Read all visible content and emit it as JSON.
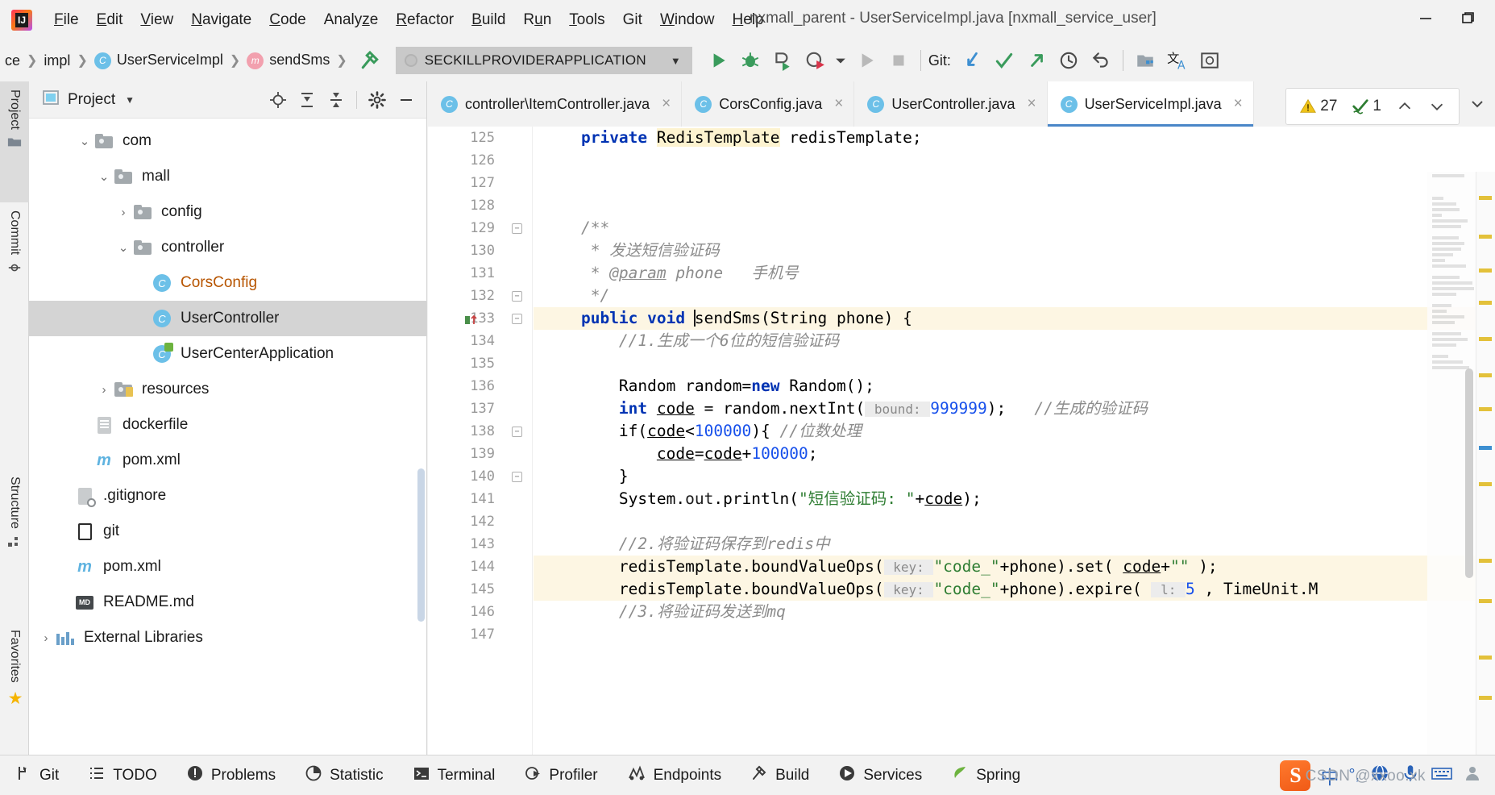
{
  "window": {
    "title": "nxmall_parent - UserServiceImpl.java [nxmall_service_user]",
    "minimize_icon": "minimize-icon",
    "restore_icon": "restore-icon"
  },
  "menubar": {
    "logo": "intellij-idea-logo",
    "items": [
      {
        "label": "File",
        "mnemonic": "F"
      },
      {
        "label": "Edit",
        "mnemonic": "E"
      },
      {
        "label": "View",
        "mnemonic": "V"
      },
      {
        "label": "Navigate",
        "mnemonic": "N"
      },
      {
        "label": "Code",
        "mnemonic": "C"
      },
      {
        "label": "Analyze",
        "mnemonic": "z"
      },
      {
        "label": "Refactor",
        "mnemonic": "R"
      },
      {
        "label": "Build",
        "mnemonic": "B"
      },
      {
        "label": "Run",
        "mnemonic": "u"
      },
      {
        "label": "Tools",
        "mnemonic": "T"
      },
      {
        "label": "Git",
        "mnemonic": ""
      },
      {
        "label": "Window",
        "mnemonic": "W"
      },
      {
        "label": "Help",
        "mnemonic": "H"
      }
    ]
  },
  "navbar": {
    "breadcrumbs": [
      {
        "label": "ce",
        "icon": "none"
      },
      {
        "label": "impl",
        "icon": "none"
      },
      {
        "label": "UserServiceImpl",
        "icon": "class-icon"
      },
      {
        "label": "sendSms",
        "icon": "method-icon"
      }
    ],
    "build_icon": "hammer-icon",
    "run_configuration": "SECKILLPROVIDERAPPLICATION",
    "run_config_arrow": "chevron-down-icon",
    "toolbar_icons": [
      "run-icon",
      "debug-icon",
      "run-with-coverage-icon",
      "profile-icon",
      "dropdown-icon",
      "rerun-icon",
      "stop-icon"
    ],
    "git_label": "Git:",
    "git_icons": [
      "update-project-icon",
      "commit-icon",
      "push-icon",
      "history-icon",
      "rollback-icon"
    ],
    "right_icons": [
      "project-structure-icon",
      "translate-icon",
      "search-everywhere-icon"
    ]
  },
  "left_stripe": {
    "items": [
      {
        "label": "Project",
        "icon": "project-folder-icon",
        "active": true
      },
      {
        "label": "Commit",
        "icon": "commit-diamond-icon",
        "active": false
      },
      {
        "label": "Structure",
        "icon": "structure-icon",
        "active": false
      },
      {
        "label": "Favorites",
        "icon": "star-icon",
        "active": false
      }
    ]
  },
  "project_panel": {
    "title": "Project",
    "title_caret": "chevron-down-icon",
    "actions": [
      "locate-icon",
      "expand-all-icon",
      "collapse-all-icon",
      "gear-icon",
      "hide-icon"
    ],
    "tree": [
      {
        "label": "com",
        "icon": "folder-icon",
        "arrow": "expanded",
        "indent": 3,
        "selected": false
      },
      {
        "label": "mall",
        "icon": "folder-icon",
        "arrow": "expanded",
        "indent": 4,
        "selected": false
      },
      {
        "label": "config",
        "icon": "folder-icon",
        "arrow": "collapsed",
        "indent": 5,
        "selected": false
      },
      {
        "label": "controller",
        "icon": "folder-icon",
        "arrow": "expanded",
        "indent": 5,
        "selected": false
      },
      {
        "label": "CorsConfig",
        "icon": "class-icon",
        "arrow": "none",
        "indent": 6,
        "selected": false,
        "color": "orange"
      },
      {
        "label": "UserController",
        "icon": "class-icon",
        "arrow": "none",
        "indent": 6,
        "selected": true
      },
      {
        "label": "UserCenterApplication",
        "icon": "spring-class-icon",
        "arrow": "none",
        "indent": 6,
        "selected": false
      },
      {
        "label": "resources",
        "icon": "resources-folder-icon",
        "arrow": "collapsed",
        "indent": 4,
        "selected": false
      },
      {
        "label": "dockerfile",
        "icon": "file-icon",
        "arrow": "none",
        "indent": 3,
        "selected": false
      },
      {
        "label": "pom.xml",
        "icon": "maven-icon",
        "arrow": "none",
        "indent": 3,
        "selected": false
      },
      {
        "label": ".gitignore",
        "icon": "gitignore-icon",
        "arrow": "none",
        "indent": 2,
        "selected": false
      },
      {
        "label": "git",
        "icon": "plain-file-icon",
        "arrow": "none",
        "indent": 2,
        "selected": false
      },
      {
        "label": "pom.xml",
        "icon": "maven-icon",
        "arrow": "none",
        "indent": 2,
        "selected": false
      },
      {
        "label": "README.md",
        "icon": "markdown-icon",
        "arrow": "none",
        "indent": 2,
        "selected": false
      },
      {
        "label": "External Libraries",
        "icon": "libraries-icon",
        "arrow": "collapsed",
        "indent": 1,
        "selected": false
      }
    ]
  },
  "editor": {
    "tabs": [
      {
        "label": "controller\\ItemController.java",
        "icon": "class-icon",
        "active": false,
        "close": "×"
      },
      {
        "label": "CorsConfig.java",
        "icon": "class-icon",
        "active": false,
        "close": "×"
      },
      {
        "label": "UserController.java",
        "icon": "class-icon",
        "active": false,
        "close": "×"
      },
      {
        "label": "UserServiceImpl.java",
        "icon": "class-icon",
        "active": true,
        "close": "×"
      }
    ],
    "tab_overflow_icon": "chevron-down-icon",
    "inspection": {
      "warning_icon": "warning-triangle-icon",
      "warning_count": "27",
      "ok_icon": "inspection-ok-icon",
      "ok_count": "1",
      "prev_icon": "chevron-up-icon",
      "next_icon": "chevron-down-icon"
    },
    "first_line_number": 125,
    "lines": [
      {
        "n": 125,
        "fold": false,
        "marker": "",
        "highlight": false,
        "partial": true,
        "tokens": [
          {
            "t": "    ",
            "c": "pl"
          },
          {
            "t": "private ",
            "c": "kw"
          },
          {
            "t": "RedisTemplate",
            "c": "ylwhl"
          },
          {
            "t": " redisTemplate;",
            "c": "pl"
          }
        ]
      },
      {
        "n": 126,
        "fold": false,
        "marker": "",
        "tokens": []
      },
      {
        "n": 127,
        "fold": false,
        "marker": "",
        "tokens": []
      },
      {
        "n": 128,
        "fold": false,
        "marker": "",
        "tokens": []
      },
      {
        "n": 129,
        "fold": true,
        "marker": "",
        "tokens": [
          {
            "t": "    /**",
            "c": "jd"
          }
        ]
      },
      {
        "n": 130,
        "fold": false,
        "marker": "",
        "tokens": [
          {
            "t": "     * 发送短信验证码",
            "c": "jd"
          }
        ]
      },
      {
        "n": 131,
        "fold": false,
        "marker": "",
        "tokens": [
          {
            "t": "     * ",
            "c": "jd"
          },
          {
            "t": "@param",
            "c": "jdtag"
          },
          {
            "t": " phone   手机号",
            "c": "jd"
          }
        ]
      },
      {
        "n": 132,
        "fold": true,
        "marker": "",
        "tokens": [
          {
            "t": "     */",
            "c": "jd"
          }
        ]
      },
      {
        "n": 133,
        "fold": true,
        "marker": "override-icon",
        "highlight": true,
        "tokens": [
          {
            "t": "    ",
            "c": "pl"
          },
          {
            "t": "public ",
            "c": "kw"
          },
          {
            "t": "void ",
            "c": "kw"
          },
          {
            "t": "|",
            "c": "caret"
          },
          {
            "t": "sendSms(String phone) {",
            "c": "pl"
          }
        ]
      },
      {
        "n": 134,
        "fold": false,
        "marker": "",
        "tokens": [
          {
            "t": "        //1.生成一个6位的短信验证码",
            "c": "cm"
          }
        ]
      },
      {
        "n": 135,
        "fold": false,
        "marker": "",
        "tokens": []
      },
      {
        "n": 136,
        "fold": false,
        "marker": "",
        "tokens": [
          {
            "t": "        Random random=",
            "c": "pl"
          },
          {
            "t": "new ",
            "c": "kw"
          },
          {
            "t": "Random();",
            "c": "pl"
          }
        ]
      },
      {
        "n": 137,
        "fold": false,
        "marker": "",
        "tokens": [
          {
            "t": "        ",
            "c": "pl"
          },
          {
            "t": "int ",
            "c": "kw"
          },
          {
            "t": "code",
            "c": "und"
          },
          {
            "t": " = random.nextInt(",
            "c": "pl"
          },
          {
            "t": " bound: ",
            "c": "hintbg"
          },
          {
            "t": "999999",
            "c": "num"
          },
          {
            "t": ");   ",
            "c": "pl"
          },
          {
            "t": "//生成的验证码",
            "c": "cm"
          }
        ]
      },
      {
        "n": 138,
        "fold": true,
        "marker": "",
        "tokens": [
          {
            "t": "        if(",
            "c": "pl"
          },
          {
            "t": "code",
            "c": "und"
          },
          {
            "t": "<",
            "c": "pl"
          },
          {
            "t": "100000",
            "c": "num"
          },
          {
            "t": "){ ",
            "c": "pl"
          },
          {
            "t": "//位数处理",
            "c": "cm"
          }
        ]
      },
      {
        "n": 139,
        "fold": false,
        "marker": "",
        "tokens": [
          {
            "t": "            ",
            "c": "pl"
          },
          {
            "t": "code",
            "c": "und"
          },
          {
            "t": "=",
            "c": "pl"
          },
          {
            "t": "code",
            "c": "und"
          },
          {
            "t": "+",
            "c": "pl"
          },
          {
            "t": "100000",
            "c": "num"
          },
          {
            "t": ";",
            "c": "pl"
          }
        ]
      },
      {
        "n": 140,
        "fold": true,
        "marker": "",
        "tokens": [
          {
            "t": "        }",
            "c": "pl"
          }
        ]
      },
      {
        "n": 141,
        "fold": false,
        "marker": "",
        "tokens": [
          {
            "t": "        System.",
            "c": "pl"
          },
          {
            "t": "out",
            "c": "fld2"
          },
          {
            "t": ".println(",
            "c": "pl"
          },
          {
            "t": "\"短信验证码: \"",
            "c": "str"
          },
          {
            "t": "+",
            "c": "pl"
          },
          {
            "t": "code",
            "c": "und"
          },
          {
            "t": ");",
            "c": "pl"
          }
        ]
      },
      {
        "n": 142,
        "fold": false,
        "marker": "",
        "tokens": []
      },
      {
        "n": 143,
        "fold": false,
        "marker": "",
        "tokens": [
          {
            "t": "        //2.将验证码保存到redis中",
            "c": "cm"
          }
        ]
      },
      {
        "n": 144,
        "fold": false,
        "marker": "",
        "highlight": true,
        "tokens": [
          {
            "t": "        redisTemplate.boundValueOps(",
            "c": "pl"
          },
          {
            "t": " key: ",
            "c": "hintbg"
          },
          {
            "t": "\"code_\"",
            "c": "str"
          },
          {
            "t": "+phone).set( ",
            "c": "pl"
          },
          {
            "t": "code",
            "c": "und"
          },
          {
            "t": "+",
            "c": "pl"
          },
          {
            "t": "\"\"",
            "c": "str"
          },
          {
            "t": " );",
            "c": "pl"
          }
        ]
      },
      {
        "n": 145,
        "fold": false,
        "marker": "",
        "highlight": true,
        "tokens": [
          {
            "t": "        redisTemplate.boundValueOps(",
            "c": "pl"
          },
          {
            "t": " key: ",
            "c": "hintbg"
          },
          {
            "t": "\"code_\"",
            "c": "str"
          },
          {
            "t": "+phone).expire( ",
            "c": "pl"
          },
          {
            "t": " l: ",
            "c": "hintbg"
          },
          {
            "t": "5",
            "c": "num"
          },
          {
            "t": " , TimeUnit.M",
            "c": "pl"
          }
        ]
      },
      {
        "n": 146,
        "fold": false,
        "marker": "",
        "tokens": [
          {
            "t": "        //3.将验证码发送到mq",
            "c": "cm"
          }
        ]
      },
      {
        "n": 147,
        "fold": false,
        "marker": "",
        "tokens": []
      }
    ]
  },
  "statusbar": {
    "items": [
      {
        "label": "Git",
        "icon": "git-branch-icon"
      },
      {
        "label": "TODO",
        "icon": "todo-list-icon"
      },
      {
        "label": "Problems",
        "icon": "problems-icon"
      },
      {
        "label": "Statistic",
        "icon": "statistic-icon"
      },
      {
        "label": "Terminal",
        "icon": "terminal-icon"
      },
      {
        "label": "Profiler",
        "icon": "profiler-icon"
      },
      {
        "label": "Endpoints",
        "icon": "endpoints-icon"
      },
      {
        "label": "Build",
        "icon": "build-hammer-icon"
      },
      {
        "label": "Services",
        "icon": "services-icon"
      },
      {
        "label": "Spring",
        "icon": "spring-leaf-icon"
      }
    ],
    "tray": [
      "sogou-ime-icon",
      "chinese-mode-icon",
      "punctuation-icon",
      "globe-icon",
      "mic-icon",
      "keyboard-icon",
      "user-icon"
    ],
    "sogou_letter": "S",
    "chinese_char": "中",
    "punct_char": "°,"
  },
  "watermark": "CSDN @xxoo.xk"
}
